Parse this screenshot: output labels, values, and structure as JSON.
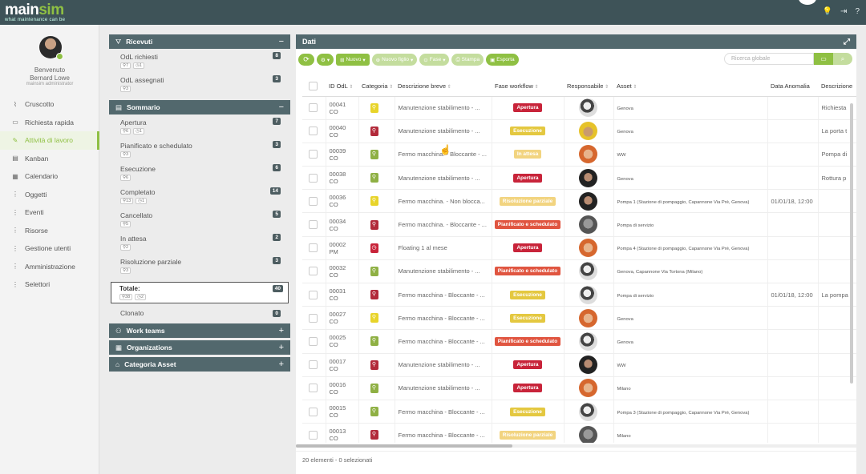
{
  "app": {
    "logo_main": "main",
    "logo_accent": "sim",
    "tagline": "what maintenance can be"
  },
  "user": {
    "greeting": "Benvenuto",
    "name": "Bernard Lowe",
    "role": "mainsim administrator"
  },
  "nav": [
    {
      "icon": "chart-icon",
      "glyph": "⌇",
      "label": "Cruscotto",
      "active": false
    },
    {
      "icon": "request-icon",
      "glyph": "▭",
      "label": "Richiesta rapida",
      "active": false
    },
    {
      "icon": "wrench-icon",
      "glyph": "✎",
      "label": "Attività di lavoro",
      "active": true
    },
    {
      "icon": "kanban-icon",
      "glyph": "▤",
      "label": "Kanban",
      "active": false
    },
    {
      "icon": "calendar-icon",
      "glyph": "▦",
      "label": "Calendario",
      "active": false
    },
    {
      "icon": "dots-icon",
      "glyph": "⋮",
      "label": "Oggetti",
      "active": false
    },
    {
      "icon": "dots-icon",
      "glyph": "⋮",
      "label": "Eventi",
      "active": false
    },
    {
      "icon": "dots-icon",
      "glyph": "⋮",
      "label": "Risorse",
      "active": false
    },
    {
      "icon": "dots-icon",
      "glyph": "⋮",
      "label": "Gestione utenti",
      "active": false
    },
    {
      "icon": "dots-icon",
      "glyph": "⋮",
      "label": "Amministrazione",
      "active": false
    },
    {
      "icon": "dots-icon",
      "glyph": "⋮",
      "label": "Selettori",
      "active": false
    }
  ],
  "ricevuti": {
    "title": "Ricevuti",
    "items": [
      {
        "label": "OdL richiesti",
        "count": "8",
        "chips": [
          "7",
          "1"
        ]
      },
      {
        "label": "OdL assegnati",
        "count": "3",
        "chips": [
          "3"
        ]
      }
    ]
  },
  "sommario": {
    "title": "Sommario",
    "items": [
      {
        "label": "Apertura",
        "count": "7",
        "chips": [
          "6",
          "1"
        ]
      },
      {
        "label": "Pianificato e schedulato",
        "count": "3",
        "chips": [
          "3"
        ]
      },
      {
        "label": "Esecuzione",
        "count": "6",
        "chips": [
          "6"
        ]
      },
      {
        "label": "Completato",
        "count": "14",
        "chips": [
          "13",
          "1"
        ]
      },
      {
        "label": "Cancellato",
        "count": "5",
        "chips": [
          "5"
        ]
      },
      {
        "label": "In attesa",
        "count": "2",
        "chips": [
          "2"
        ]
      },
      {
        "label": "Risoluzione parziale",
        "count": "3",
        "chips": [
          "3"
        ]
      }
    ],
    "totale": {
      "label": "Totale:",
      "count": "40",
      "chips": [
        "38",
        "2"
      ]
    },
    "clonato": {
      "label": "Clonato",
      "count": "0"
    }
  },
  "sections": [
    {
      "title": "Work teams"
    },
    {
      "title": "Organizations"
    },
    {
      "title": "Categoria Asset"
    }
  ],
  "dati": {
    "title": "Dati"
  },
  "toolbar": {
    "nuovo": "Nuovo",
    "nuovo_figlio": "Nuovo figlio",
    "fase": "Fase",
    "stampa": "Stampa",
    "esporta": "Esporta",
    "search_placeholder": "Ricerca globale"
  },
  "columns": [
    "ID OdL",
    "Categoria",
    "Descrizione breve",
    "Fase workflow",
    "Responsabile",
    "Asset",
    "Data Anomalia",
    "Descrizione"
  ],
  "rows": [
    {
      "id": "00041",
      "sub": "CO",
      "cat": "#e8d42a",
      "desc": "Manutenzione stabilimento - ...",
      "phase": "Apertura",
      "pc": "#c8243a",
      "av": "bw",
      "asset": "Genova",
      "date": "",
      "d2": "Richiesta"
    },
    {
      "id": "00040",
      "sub": "CO",
      "cat": "#b22a3a",
      "desc": "Manutenzione stabilimento - ...",
      "phase": "Esecuzione",
      "pc": "#e4c840",
      "av": "yellow",
      "asset": "Genova",
      "date": "",
      "d2": "La porta t"
    },
    {
      "id": "00039",
      "sub": "CO",
      "cat": "#8fb044",
      "desc": "Fermo macchina. - Bloccante - ...",
      "phase": "In attesa",
      "pc": "#f2d480",
      "av": "orange",
      "asset": "WW",
      "date": "",
      "d2": "Pompa di"
    },
    {
      "id": "00038",
      "sub": "CO",
      "cat": "#8fb044",
      "desc": "Manutenzione stabilimento - ...",
      "phase": "Apertura",
      "pc": "#c8243a",
      "av": "dark",
      "asset": "Genova",
      "date": "",
      "d2": "Rottura p"
    },
    {
      "id": "00036",
      "sub": "CO",
      "cat": "#e8d42a",
      "desc": "Fermo macchina. - Non blocca...",
      "phase": "Risoluzione parziale",
      "pc": "#f2d480",
      "av": "dark",
      "asset": "Pompa 1 (Stazione di pompaggio, Capannone Via Prè, Genova)",
      "date": "01/01/18, 12:00",
      "d2": ""
    },
    {
      "id": "00034",
      "sub": "CO",
      "cat": "#b22a3a",
      "desc": "Fermo macchina. - Bloccante - ...",
      "phase": "Pianificato e schedulato",
      "pc": "#e05540",
      "av": "grey",
      "asset": "Pompa di servizio",
      "date": "",
      "d2": ""
    },
    {
      "id": "00002",
      "sub": "PM",
      "cat": "#c8243a",
      "desc": "Floating 1 al mese",
      "phase": "Apertura",
      "pc": "#c8243a",
      "av": "orange",
      "asset": "Pompa 4 (Stazione di pompaggio, Capannone Via Prè, Genova)",
      "date": "",
      "d2": ""
    },
    {
      "id": "00032",
      "sub": "CO",
      "cat": "#8fb044",
      "desc": "Manutenzione stabilimento - ...",
      "phase": "Pianificato e schedulato",
      "pc": "#e05540",
      "av": "bw",
      "asset": "Genova, Capannone Via Tortona (Milano)",
      "date": "",
      "d2": ""
    },
    {
      "id": "00031",
      "sub": "CO",
      "cat": "#b22a3a",
      "desc": "Fermo macchina - Bloccante - ...",
      "phase": "Esecuzione",
      "pc": "#e4c840",
      "av": "bw",
      "asset": "Pompa di servizio",
      "date": "01/01/18, 12:00",
      "d2": "La pompa"
    },
    {
      "id": "00027",
      "sub": "CO",
      "cat": "#e8d42a",
      "desc": "Fermo macchina - Bloccante - ...",
      "phase": "Esecuzione",
      "pc": "#e4c840",
      "av": "orange",
      "asset": "Genova",
      "date": "",
      "d2": ""
    },
    {
      "id": "00025",
      "sub": "CO",
      "cat": "#8fb044",
      "desc": "Fermo macchina - Bloccante - ...",
      "phase": "Pianificato e schedulato",
      "pc": "#e05540",
      "av": "bw",
      "asset": "Genova",
      "date": "",
      "d2": ""
    },
    {
      "id": "00017",
      "sub": "CO",
      "cat": "#b22a3a",
      "desc": "Manutenzione stabilimento - ...",
      "phase": "Apertura",
      "pc": "#c8243a",
      "av": "dark",
      "asset": "WW",
      "date": "",
      "d2": ""
    },
    {
      "id": "00016",
      "sub": "CO",
      "cat": "#8fb044",
      "desc": "Manutenzione stabilimento - ...",
      "phase": "Apertura",
      "pc": "#c8243a",
      "av": "orange",
      "asset": "Milano",
      "date": "",
      "d2": ""
    },
    {
      "id": "00015",
      "sub": "CO",
      "cat": "#8fb044",
      "desc": "Fermo macchina - Bloccante - ...",
      "phase": "Esecuzione",
      "pc": "#e4c840",
      "av": "bw",
      "asset": "Pompa 3 (Stazione di pompaggio, Capannone Via Prè, Genova)",
      "date": "",
      "d2": ""
    },
    {
      "id": "00013",
      "sub": "CO",
      "cat": "#b22a3a",
      "desc": "Fermo macchina - Bloccante - ...",
      "phase": "Risoluzione parziale",
      "pc": "#f2d480",
      "av": "grey",
      "asset": "Milano",
      "date": "",
      "d2": ""
    }
  ],
  "footer": {
    "text": "20 elementi - 0 selezionati"
  }
}
